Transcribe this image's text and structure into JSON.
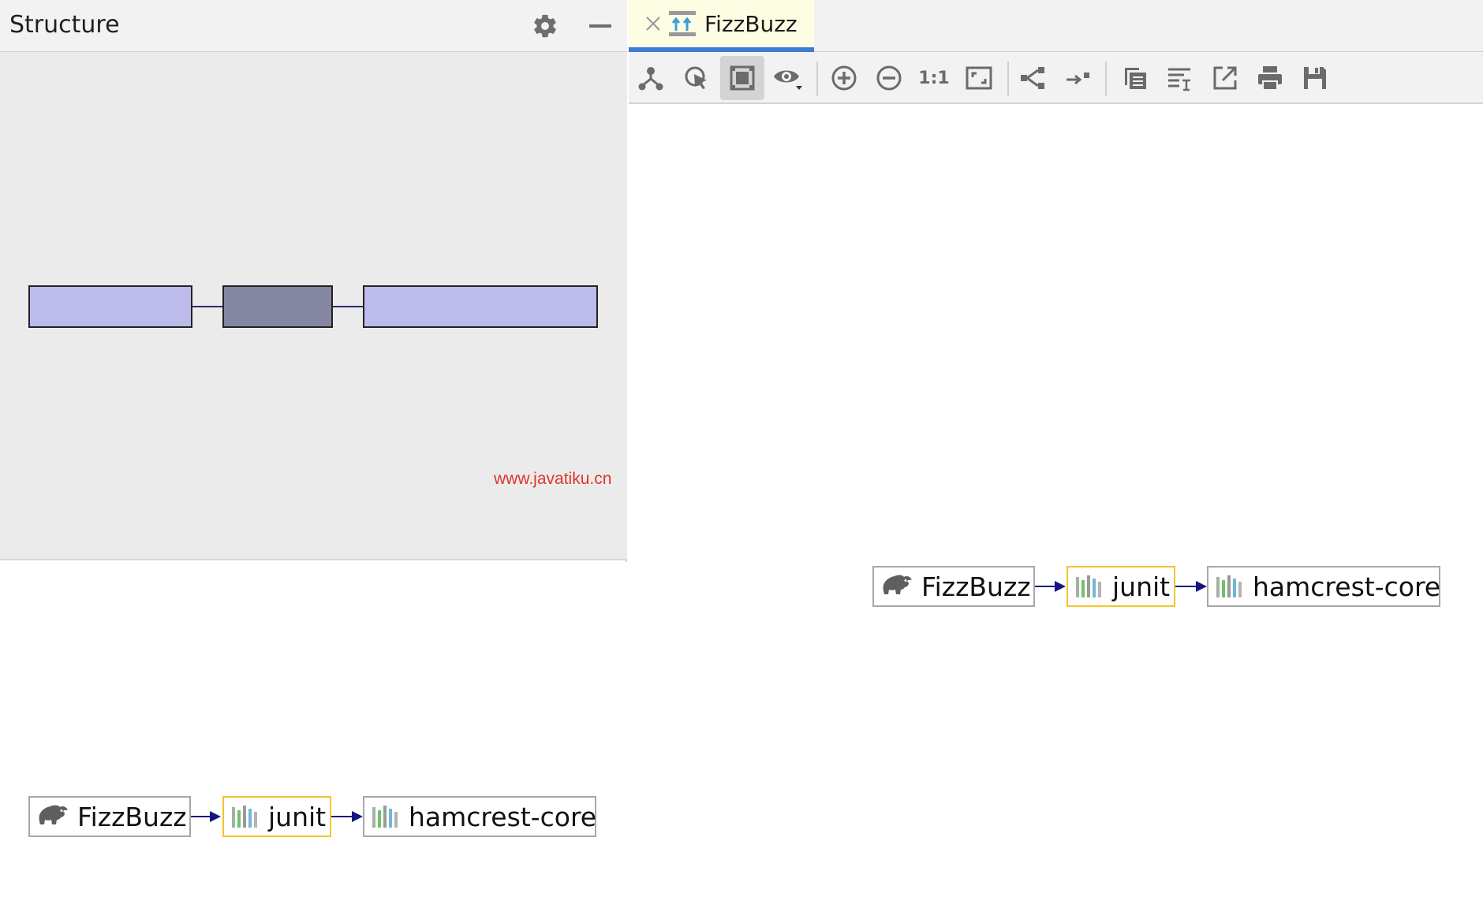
{
  "structure_panel": {
    "title": "Structure",
    "gear_icon": "gear-icon",
    "minimize_icon": "minimize-icon",
    "overview_colors": {
      "node": "#bcbbec",
      "selected_node": "#8586a2",
      "edge": "#2b2b6b"
    }
  },
  "watermark": "www.javatiku.cn",
  "editor": {
    "tab": {
      "label": "FizzBuzz",
      "icon": "gradle-diagram-icon",
      "close_icon": "close-icon"
    },
    "toolbar": [
      {
        "name": "layout-icon"
      },
      {
        "name": "select-cursor-icon"
      },
      {
        "name": "fit-content-icon",
        "active": true
      },
      {
        "name": "visibility-eye-icon"
      },
      {
        "name": "zoom-in-icon"
      },
      {
        "name": "zoom-out-icon"
      },
      {
        "name": "actual-size-icon",
        "label": "1:1"
      },
      {
        "name": "fit-window-icon"
      },
      {
        "name": "tree-layout-icon"
      },
      {
        "name": "apply-layout-icon"
      },
      {
        "name": "copy-diagram-icon"
      },
      {
        "name": "edit-text-icon"
      },
      {
        "name": "export-icon"
      },
      {
        "name": "print-icon"
      },
      {
        "name": "save-icon"
      }
    ]
  },
  "graph": {
    "nodes": [
      {
        "label": "FizzBuzz",
        "icon": "gradle-elephant-icon",
        "selected": false
      },
      {
        "label": "junit",
        "icon": "library-icon",
        "selected": true
      },
      {
        "label": "hamcrest-core",
        "icon": "library-icon",
        "selected": false
      }
    ],
    "colors": {
      "edge": "#151580",
      "selected_border": "#f2c530",
      "node_border": "#a8a8a8"
    }
  }
}
